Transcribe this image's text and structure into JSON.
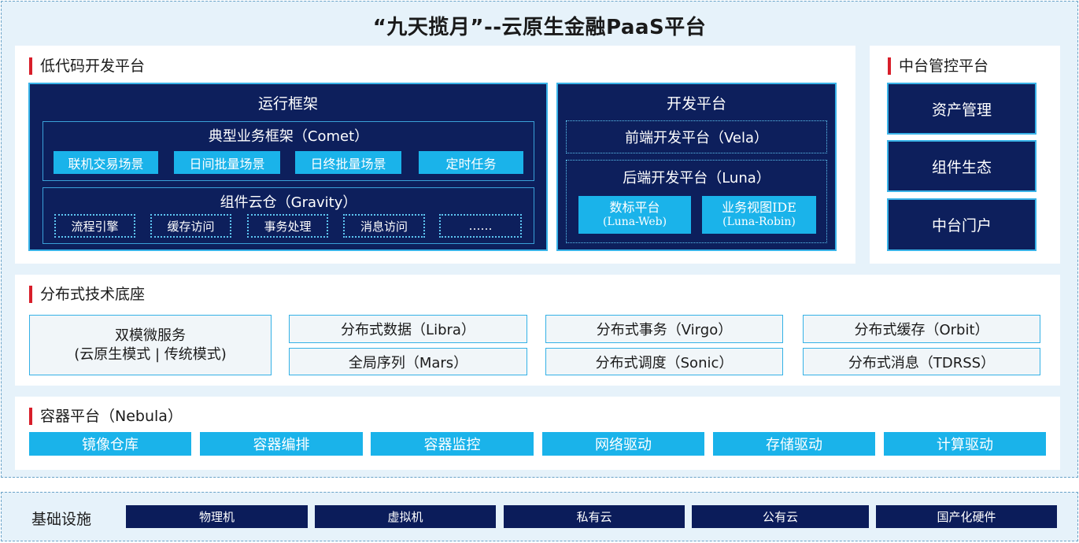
{
  "title": "“九天揽月”--云原生金融PaaS平台",
  "lowcode": {
    "section_title": "低代码开发平台",
    "runtime": {
      "title": "运行框架",
      "typical": {
        "title": "典型业务框架（Comet）",
        "items": [
          "联机交易场景",
          "日间批量场景",
          "日终批量场景",
          "定时任务"
        ]
      },
      "gravity": {
        "title": "组件云仓（Gravity）",
        "items": [
          "流程引擎",
          "缓存访问",
          "事务处理",
          "消息访问",
          "……"
        ]
      }
    },
    "devplatform": {
      "title": "开发平台",
      "frontend": "前端开发平台（Vela）",
      "backend": {
        "title": "后端开发平台（Luna）",
        "items": [
          {
            "name": "数标平台",
            "sub": "(Luna-Web)"
          },
          {
            "name": "业务视图IDE",
            "sub": "(Luna-Robin)"
          }
        ]
      }
    }
  },
  "midplatform": {
    "section_title": "中台管控平台",
    "items": [
      "资产管理",
      "组件生态",
      "中台门户"
    ]
  },
  "distributed": {
    "section_title": "分布式技术底座",
    "dual": {
      "line1": "双模微服务",
      "line2": "(云原生模式 | 传统模式)"
    },
    "items": [
      "分布式数据（Libra）",
      "分布式事务（Virgo）",
      "分布式缓存（Orbit）",
      "全局序列（Mars）",
      "分布式调度（Sonic）",
      "分布式消息（TDRSS）"
    ]
  },
  "container": {
    "section_title": "容器平台（Nebula）",
    "items": [
      "镜像仓库",
      "容器编排",
      "容器监控",
      "网络驱动",
      "存储驱动",
      "计算驱动"
    ]
  },
  "infra": {
    "label": "基础设施",
    "items": [
      "物理机",
      "虚拟机",
      "私有云",
      "公有云",
      "国产化硬件"
    ]
  },
  "colors": {
    "navy": "#0d1f5c",
    "cyan": "#1ab3ea",
    "accent_red": "#d81e2a",
    "background": "#e6f2fa"
  }
}
